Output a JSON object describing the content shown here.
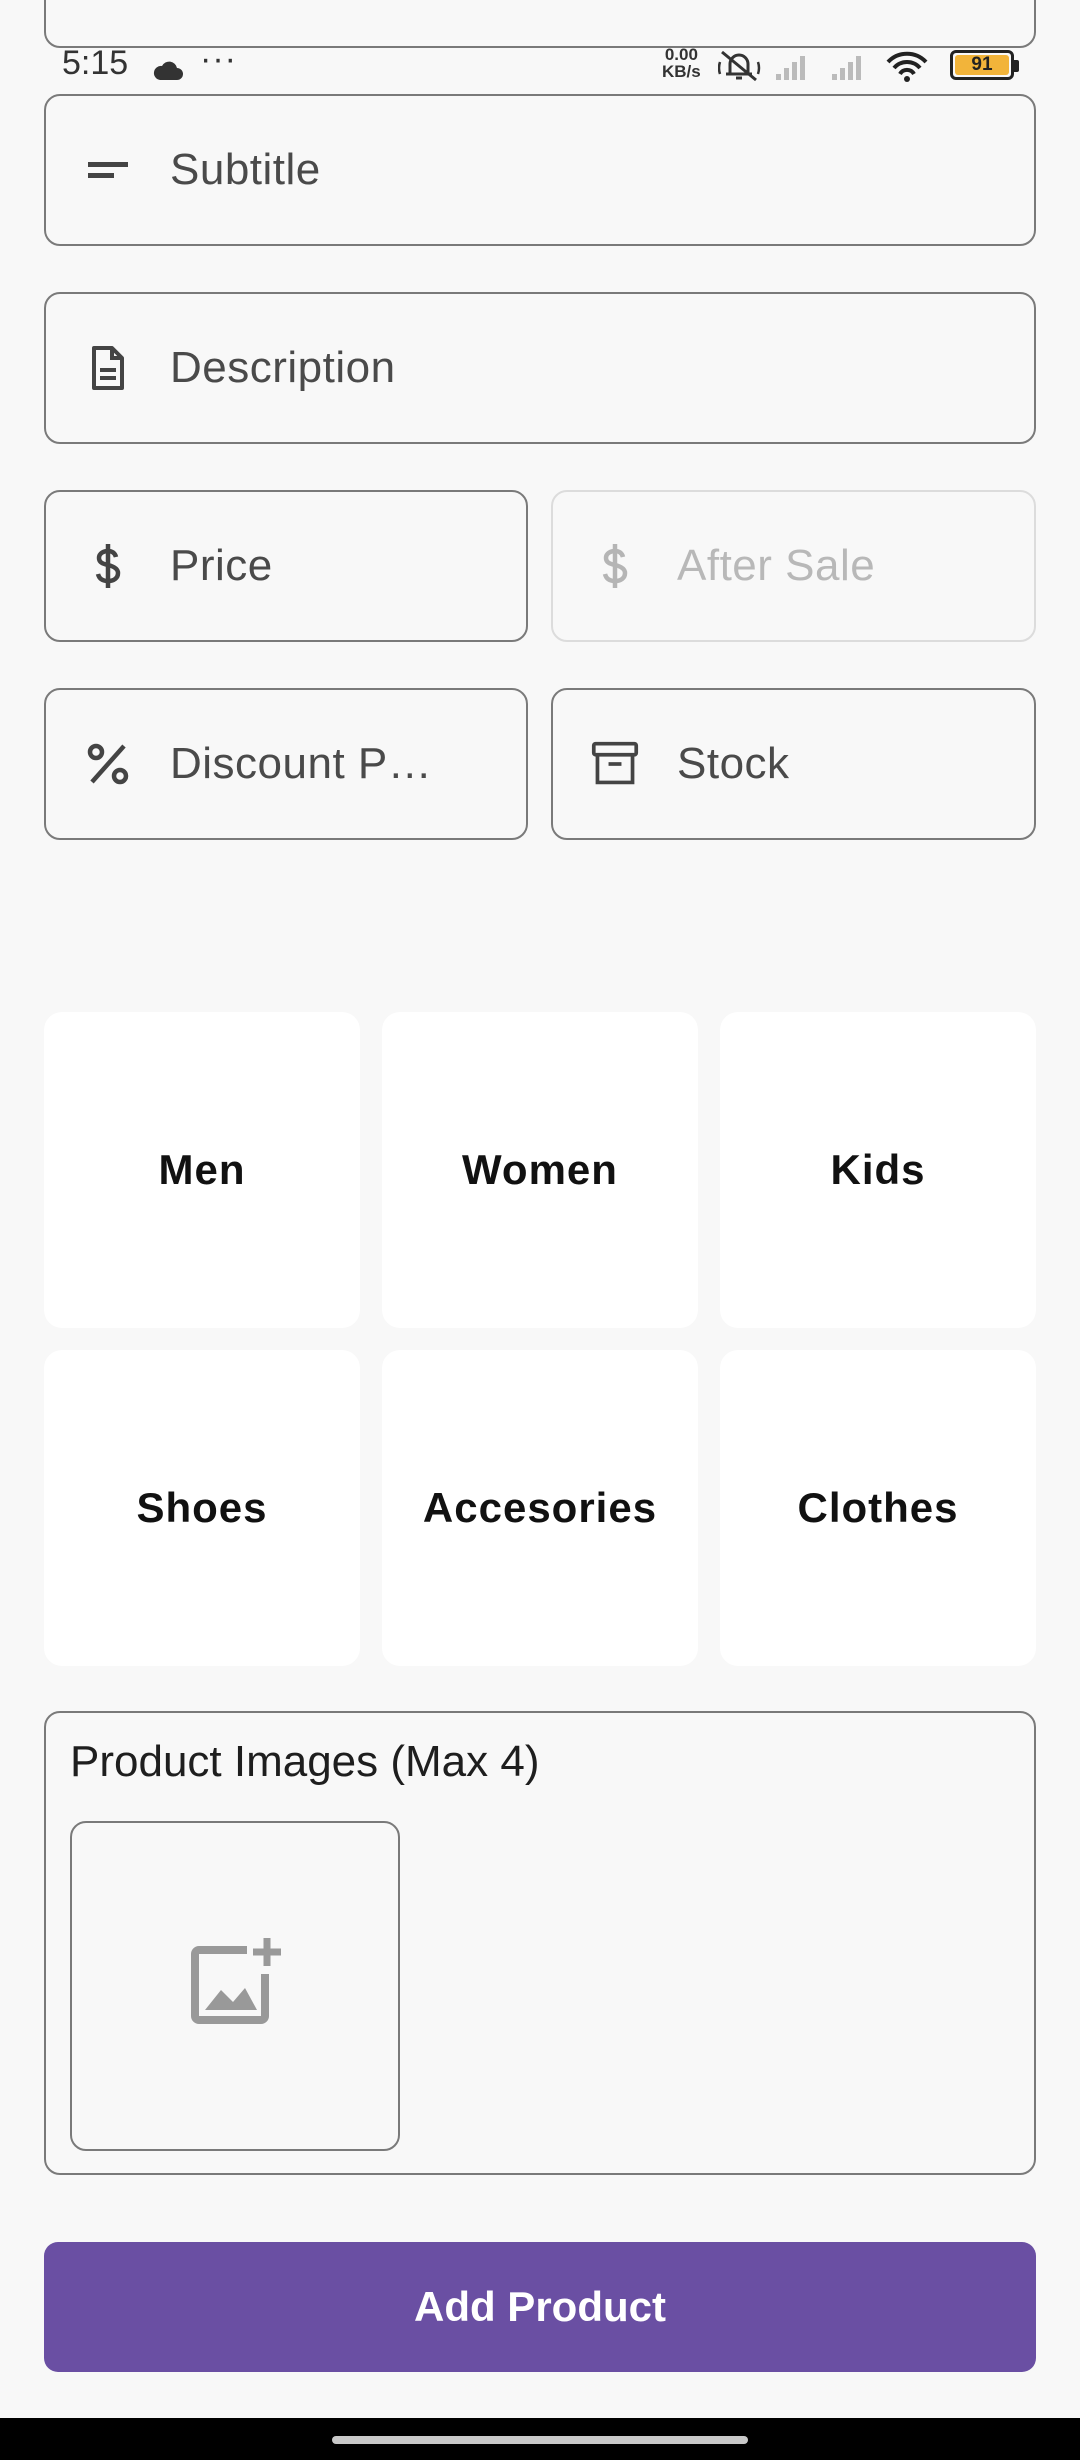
{
  "status_bar": {
    "time": "5:15",
    "net_speed_top": "0.00",
    "net_speed_bottom": "KB/s",
    "battery": "91",
    "battery_color": "#f2b43a"
  },
  "form": {
    "subtitle_placeholder": "Subtitle",
    "description_placeholder": "Description",
    "price_placeholder": "Price",
    "after_sale_placeholder": "After Sale",
    "discount_placeholder": "Discount Percentage",
    "stock_placeholder": "Stock",
    "icons": {
      "subtitle": "short-text-icon",
      "description": "document-icon",
      "price": "dollar-icon",
      "after_sale": "dollar-icon",
      "discount": "percent-icon",
      "stock": "archive-box-icon"
    }
  },
  "categories": [
    {
      "label": "Men"
    },
    {
      "label": "Women"
    },
    {
      "label": "Kids"
    },
    {
      "label": "Shoes"
    },
    {
      "label": "Accesories"
    },
    {
      "label": "Clothes"
    }
  ],
  "product_images": {
    "label": "Product Images (Max 4)",
    "add_icon": "add-photo-icon"
  },
  "actions": {
    "add_product_label": "Add Product",
    "accent": "#6a4fa3"
  }
}
